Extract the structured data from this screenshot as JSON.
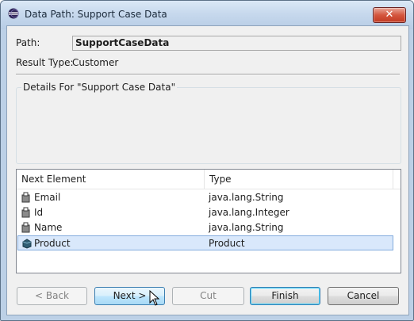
{
  "window": {
    "title": "Data Path: Support Case Data",
    "close_label": "✕"
  },
  "form": {
    "path_label": "Path:",
    "path_value": "SupportCaseData",
    "result_type_label": "Result Type:",
    "result_type_value": "Customer"
  },
  "details": {
    "group_title": "Details For \"Support Case Data\""
  },
  "table": {
    "columns": [
      "Next Element",
      "Type"
    ],
    "rows": [
      {
        "name": "Email",
        "type": "java.lang.String",
        "icon": "attribute-icon",
        "selected": false
      },
      {
        "name": "Id",
        "type": "java.lang.Integer",
        "icon": "attribute-icon",
        "selected": false
      },
      {
        "name": "Name",
        "type": "java.lang.String",
        "icon": "attribute-icon",
        "selected": false
      },
      {
        "name": "Product",
        "type": "Product",
        "icon": "class-icon",
        "selected": true
      }
    ]
  },
  "buttons": {
    "back": "< Back",
    "next": "Next >",
    "cut": "Cut",
    "finish": "Finish",
    "cancel": "Cancel"
  }
}
